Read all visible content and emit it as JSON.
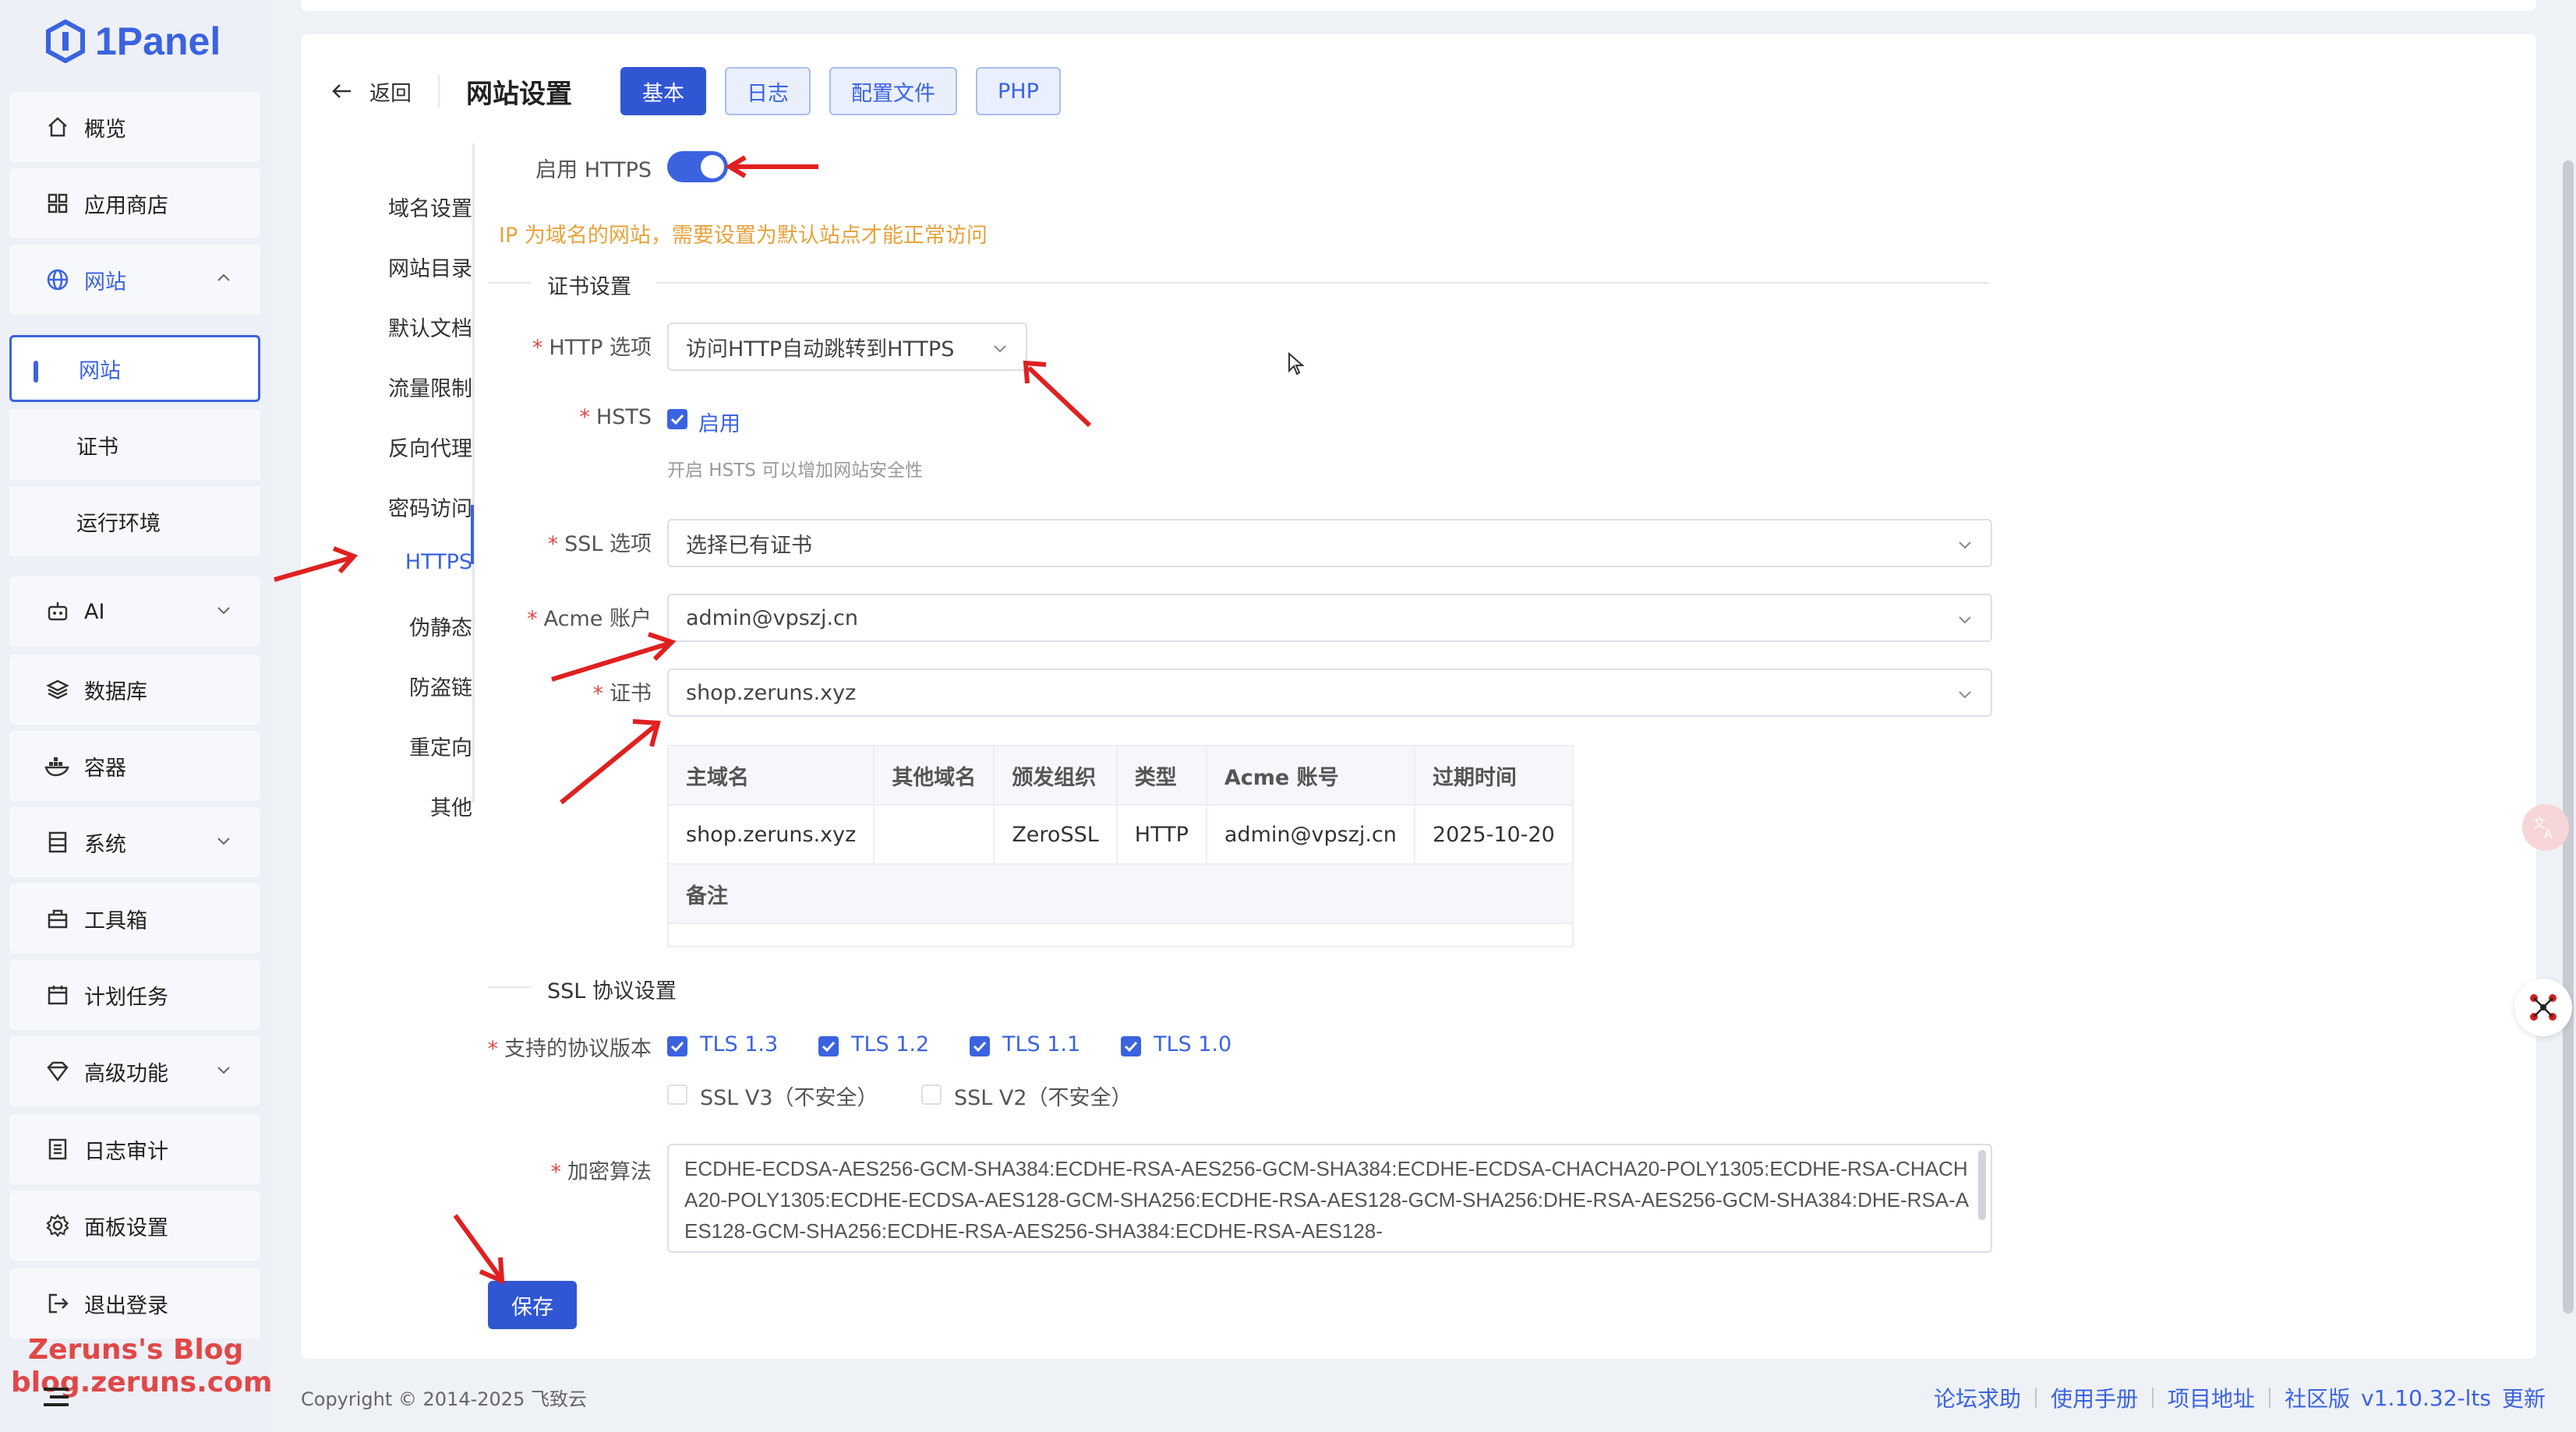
{
  "app": {
    "logo_text": "1Panel"
  },
  "sidebar": {
    "items": [
      {
        "label": "概览",
        "icon": "home-icon"
      },
      {
        "label": "应用商店",
        "icon": "grid-icon"
      },
      {
        "label": "网站",
        "icon": "globe-icon",
        "expanded": true
      },
      {
        "label": "AI",
        "icon": "robot-icon"
      },
      {
        "label": "数据库",
        "icon": "layers-icon"
      },
      {
        "label": "容器",
        "icon": "docker-icon"
      },
      {
        "label": "系统",
        "icon": "server-icon"
      },
      {
        "label": "工具箱",
        "icon": "toolbox-icon"
      },
      {
        "label": "计划任务",
        "icon": "calendar-icon"
      },
      {
        "label": "高级功能",
        "icon": "diamond-icon"
      },
      {
        "label": "日志审计",
        "icon": "log-icon"
      },
      {
        "label": "面板设置",
        "icon": "gear-icon"
      },
      {
        "label": "退出登录",
        "icon": "logout-icon"
      }
    ],
    "sub_items": [
      {
        "label": "网站",
        "active": true
      },
      {
        "label": "证书"
      },
      {
        "label": "运行环境"
      }
    ],
    "watermark_line1": "Zeruns's Blog",
    "watermark_line2": "blog.zeruns.com"
  },
  "header": {
    "back_label": "返回",
    "title": "网站设置",
    "tabs": [
      {
        "label": "基本",
        "active": true
      },
      {
        "label": "日志"
      },
      {
        "label": "配置文件"
      },
      {
        "label": "PHP"
      }
    ]
  },
  "settings_menu": [
    "域名设置",
    "网站目录",
    "默认文档",
    "流量限制",
    "反向代理",
    "密码访问",
    "HTTPS",
    "伪静态",
    "防盗链",
    "重定向",
    "其他"
  ],
  "form": {
    "enable_https_label": "启用 HTTPS",
    "enable_https": true,
    "ip_warning": "IP 为域名的网站，需要设置为默认站点才能正常访问",
    "cert_section_title": "证书设置",
    "http_option_label": "HTTP 选项",
    "http_option_value": "访问HTTP自动跳转到HTTPS",
    "hsts_label": "HSTS",
    "hsts_checkbox_label": "启用",
    "hsts_hint": "开启 HSTS 可以增加网站安全性",
    "ssl_option_label": "SSL 选项",
    "ssl_option_value": "选择已有证书",
    "acme_label": "Acme 账户",
    "acme_value": "admin@vpszj.cn",
    "cert_label": "证书",
    "cert_value": "shop.zeruns.xyz",
    "cert_table": {
      "headers": [
        "主域名",
        "其他域名",
        "颁发组织",
        "类型",
        "Acme 账号",
        "过期时间"
      ],
      "row": [
        "shop.zeruns.xyz",
        "",
        "ZeroSSL",
        "HTTP",
        "admin@vpszj.cn",
        "2025-10-20"
      ],
      "remark_header": "备注"
    },
    "ssl_protocol_section_title": "SSL 协议设置",
    "protocol_label": "支持的协议版本",
    "protocols": [
      {
        "label": "TLS 1.3",
        "checked": true
      },
      {
        "label": "TLS 1.2",
        "checked": true
      },
      {
        "label": "TLS 1.1",
        "checked": true
      },
      {
        "label": "TLS 1.0",
        "checked": true
      },
      {
        "label": "SSL V3（不安全）",
        "checked": false
      },
      {
        "label": "SSL V2（不安全）",
        "checked": false
      }
    ],
    "cipher_label": "加密算法",
    "cipher_value": "ECDHE-ECDSA-AES256-GCM-SHA384:ECDHE-RSA-AES256-GCM-SHA384:ECDHE-ECDSA-CHACHA20-POLY1305:ECDHE-RSA-CHACHA20-POLY1305:ECDHE-ECDSA-AES128-GCM-SHA256:ECDHE-RSA-AES128-GCM-SHA256:DHE-RSA-AES256-GCM-SHA384:DHE-RSA-AES128-GCM-SHA256:ECDHE-RSA-AES256-SHA384:ECDHE-RSA-AES128-",
    "save_label": "保存"
  },
  "footer": {
    "copyright": "Copyright © 2014-2025 飞致云",
    "links": [
      "论坛求助",
      "使用手册",
      "项目地址",
      "社区版"
    ],
    "version": "v1.10.32-lts",
    "update_label": "更新"
  },
  "colors": {
    "primary": "#3b63e0",
    "warning": "#e6a23c",
    "danger": "#e04848"
  }
}
